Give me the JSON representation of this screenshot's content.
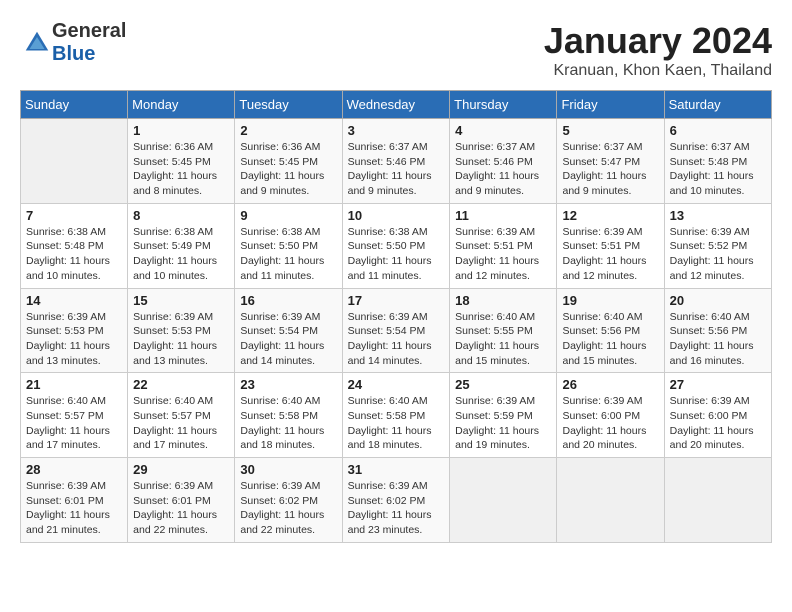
{
  "header": {
    "logo_general": "General",
    "logo_blue": "Blue",
    "month_year": "January 2024",
    "location": "Kranuan, Khon Kaen, Thailand"
  },
  "days_of_week": [
    "Sunday",
    "Monday",
    "Tuesday",
    "Wednesday",
    "Thursday",
    "Friday",
    "Saturday"
  ],
  "weeks": [
    [
      {
        "day": "",
        "sunrise": "",
        "sunset": "",
        "daylight": ""
      },
      {
        "day": "1",
        "sunrise": "Sunrise: 6:36 AM",
        "sunset": "Sunset: 5:45 PM",
        "daylight": "Daylight: 11 hours and 8 minutes."
      },
      {
        "day": "2",
        "sunrise": "Sunrise: 6:36 AM",
        "sunset": "Sunset: 5:45 PM",
        "daylight": "Daylight: 11 hours and 9 minutes."
      },
      {
        "day": "3",
        "sunrise": "Sunrise: 6:37 AM",
        "sunset": "Sunset: 5:46 PM",
        "daylight": "Daylight: 11 hours and 9 minutes."
      },
      {
        "day": "4",
        "sunrise": "Sunrise: 6:37 AM",
        "sunset": "Sunset: 5:46 PM",
        "daylight": "Daylight: 11 hours and 9 minutes."
      },
      {
        "day": "5",
        "sunrise": "Sunrise: 6:37 AM",
        "sunset": "Sunset: 5:47 PM",
        "daylight": "Daylight: 11 hours and 9 minutes."
      },
      {
        "day": "6",
        "sunrise": "Sunrise: 6:37 AM",
        "sunset": "Sunset: 5:48 PM",
        "daylight": "Daylight: 11 hours and 10 minutes."
      }
    ],
    [
      {
        "day": "7",
        "sunrise": "Sunrise: 6:38 AM",
        "sunset": "Sunset: 5:48 PM",
        "daylight": "Daylight: 11 hours and 10 minutes."
      },
      {
        "day": "8",
        "sunrise": "Sunrise: 6:38 AM",
        "sunset": "Sunset: 5:49 PM",
        "daylight": "Daylight: 11 hours and 10 minutes."
      },
      {
        "day": "9",
        "sunrise": "Sunrise: 6:38 AM",
        "sunset": "Sunset: 5:50 PM",
        "daylight": "Daylight: 11 hours and 11 minutes."
      },
      {
        "day": "10",
        "sunrise": "Sunrise: 6:38 AM",
        "sunset": "Sunset: 5:50 PM",
        "daylight": "Daylight: 11 hours and 11 minutes."
      },
      {
        "day": "11",
        "sunrise": "Sunrise: 6:39 AM",
        "sunset": "Sunset: 5:51 PM",
        "daylight": "Daylight: 11 hours and 12 minutes."
      },
      {
        "day": "12",
        "sunrise": "Sunrise: 6:39 AM",
        "sunset": "Sunset: 5:51 PM",
        "daylight": "Daylight: 11 hours and 12 minutes."
      },
      {
        "day": "13",
        "sunrise": "Sunrise: 6:39 AM",
        "sunset": "Sunset: 5:52 PM",
        "daylight": "Daylight: 11 hours and 12 minutes."
      }
    ],
    [
      {
        "day": "14",
        "sunrise": "Sunrise: 6:39 AM",
        "sunset": "Sunset: 5:53 PM",
        "daylight": "Daylight: 11 hours and 13 minutes."
      },
      {
        "day": "15",
        "sunrise": "Sunrise: 6:39 AM",
        "sunset": "Sunset: 5:53 PM",
        "daylight": "Daylight: 11 hours and 13 minutes."
      },
      {
        "day": "16",
        "sunrise": "Sunrise: 6:39 AM",
        "sunset": "Sunset: 5:54 PM",
        "daylight": "Daylight: 11 hours and 14 minutes."
      },
      {
        "day": "17",
        "sunrise": "Sunrise: 6:39 AM",
        "sunset": "Sunset: 5:54 PM",
        "daylight": "Daylight: 11 hours and 14 minutes."
      },
      {
        "day": "18",
        "sunrise": "Sunrise: 6:40 AM",
        "sunset": "Sunset: 5:55 PM",
        "daylight": "Daylight: 11 hours and 15 minutes."
      },
      {
        "day": "19",
        "sunrise": "Sunrise: 6:40 AM",
        "sunset": "Sunset: 5:56 PM",
        "daylight": "Daylight: 11 hours and 15 minutes."
      },
      {
        "day": "20",
        "sunrise": "Sunrise: 6:40 AM",
        "sunset": "Sunset: 5:56 PM",
        "daylight": "Daylight: 11 hours and 16 minutes."
      }
    ],
    [
      {
        "day": "21",
        "sunrise": "Sunrise: 6:40 AM",
        "sunset": "Sunset: 5:57 PM",
        "daylight": "Daylight: 11 hours and 17 minutes."
      },
      {
        "day": "22",
        "sunrise": "Sunrise: 6:40 AM",
        "sunset": "Sunset: 5:57 PM",
        "daylight": "Daylight: 11 hours and 17 minutes."
      },
      {
        "day": "23",
        "sunrise": "Sunrise: 6:40 AM",
        "sunset": "Sunset: 5:58 PM",
        "daylight": "Daylight: 11 hours and 18 minutes."
      },
      {
        "day": "24",
        "sunrise": "Sunrise: 6:40 AM",
        "sunset": "Sunset: 5:58 PM",
        "daylight": "Daylight: 11 hours and 18 minutes."
      },
      {
        "day": "25",
        "sunrise": "Sunrise: 6:39 AM",
        "sunset": "Sunset: 5:59 PM",
        "daylight": "Daylight: 11 hours and 19 minutes."
      },
      {
        "day": "26",
        "sunrise": "Sunrise: 6:39 AM",
        "sunset": "Sunset: 6:00 PM",
        "daylight": "Daylight: 11 hours and 20 minutes."
      },
      {
        "day": "27",
        "sunrise": "Sunrise: 6:39 AM",
        "sunset": "Sunset: 6:00 PM",
        "daylight": "Daylight: 11 hours and 20 minutes."
      }
    ],
    [
      {
        "day": "28",
        "sunrise": "Sunrise: 6:39 AM",
        "sunset": "Sunset: 6:01 PM",
        "daylight": "Daylight: 11 hours and 21 minutes."
      },
      {
        "day": "29",
        "sunrise": "Sunrise: 6:39 AM",
        "sunset": "Sunset: 6:01 PM",
        "daylight": "Daylight: 11 hours and 22 minutes."
      },
      {
        "day": "30",
        "sunrise": "Sunrise: 6:39 AM",
        "sunset": "Sunset: 6:02 PM",
        "daylight": "Daylight: 11 hours and 22 minutes."
      },
      {
        "day": "31",
        "sunrise": "Sunrise: 6:39 AM",
        "sunset": "Sunset: 6:02 PM",
        "daylight": "Daylight: 11 hours and 23 minutes."
      },
      {
        "day": "",
        "sunrise": "",
        "sunset": "",
        "daylight": ""
      },
      {
        "day": "",
        "sunrise": "",
        "sunset": "",
        "daylight": ""
      },
      {
        "day": "",
        "sunrise": "",
        "sunset": "",
        "daylight": ""
      }
    ]
  ]
}
